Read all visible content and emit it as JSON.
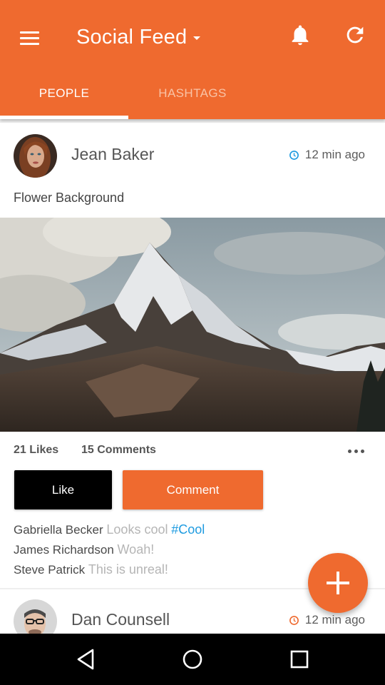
{
  "header": {
    "title": "Social Feed",
    "accent_color": "#ef6a2f",
    "icons": [
      "menu-icon",
      "dropdown-caret-icon",
      "bell-icon",
      "refresh-icon"
    ]
  },
  "tabs": [
    {
      "label": "PEOPLE",
      "active": true
    },
    {
      "label": "HASHTAGS",
      "active": false
    }
  ],
  "posts": [
    {
      "author": "Jean Baker",
      "time": "12 min ago",
      "text": "Flower Background",
      "likes": "21 Likes",
      "comments_count": "15 Comments",
      "like_label": "Like",
      "comment_label": "Comment",
      "comments": [
        {
          "author": "Gabriella Becker",
          "text": "Looks cool",
          "tag": "#Cool"
        },
        {
          "author": "James Richardson",
          "text": "Woah!"
        },
        {
          "author": "Steve Patrick",
          "text": "This is unreal!"
        }
      ]
    },
    {
      "author": "Dan Counsell",
      "time": "12 min ago"
    }
  ],
  "clock_colors": [
    "#1e9be0",
    "#ef6a2f"
  ],
  "hashtag_color": "#1e9be0",
  "fab_icon": "plus-icon",
  "nav_icons": [
    "back-icon",
    "home-icon",
    "recents-icon"
  ]
}
